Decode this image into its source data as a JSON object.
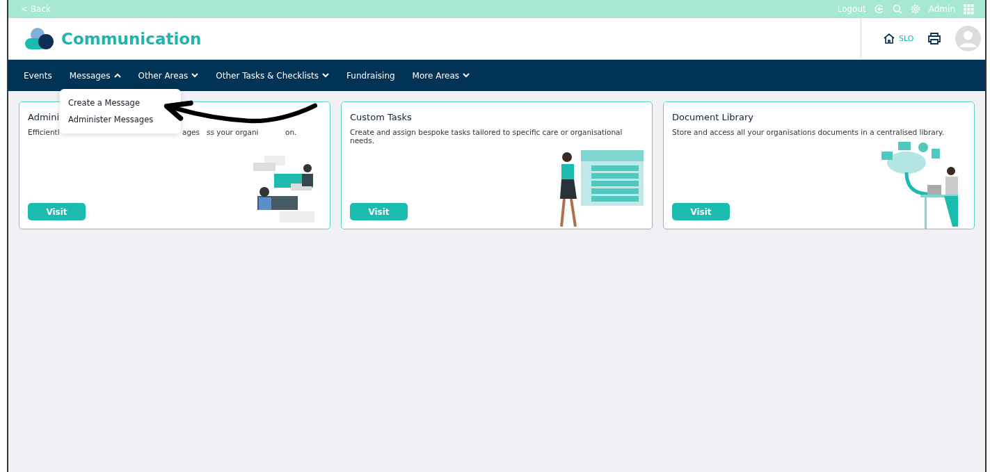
{
  "top_bar": {
    "back": "< Back",
    "logout": "Logout",
    "user": "Admin"
  },
  "header": {
    "title": "Communication",
    "site": "SLO"
  },
  "nav": [
    {
      "label": "Events",
      "kind": "link"
    },
    {
      "label": "Messages",
      "kind": "dropdown",
      "expanded": true
    },
    {
      "label": "Other Areas",
      "kind": "dropdown",
      "expanded": false
    },
    {
      "label": "Other Tasks & Checklists",
      "kind": "dropdown",
      "expanded": false
    },
    {
      "label": "Fundraising",
      "kind": "link"
    },
    {
      "label": "More Areas",
      "kind": "dropdown",
      "expanded": false
    }
  ],
  "dropdown": [
    "Create a Message",
    "Administer Messages"
  ],
  "cards": [
    {
      "title": "Admini",
      "description_parts": [
        "Efficientl",
        "ages",
        "ss your organi",
        "on."
      ],
      "button": "Visit"
    },
    {
      "title": "Custom Tasks",
      "description_parts": [
        "Create and assign bespoke tasks tailored to specific care or organisational needs."
      ],
      "button": "Visit"
    },
    {
      "title": "Document Library",
      "description_parts": [
        "Store and access all your organisations documents in a centralised library."
      ],
      "button": "Visit"
    }
  ]
}
